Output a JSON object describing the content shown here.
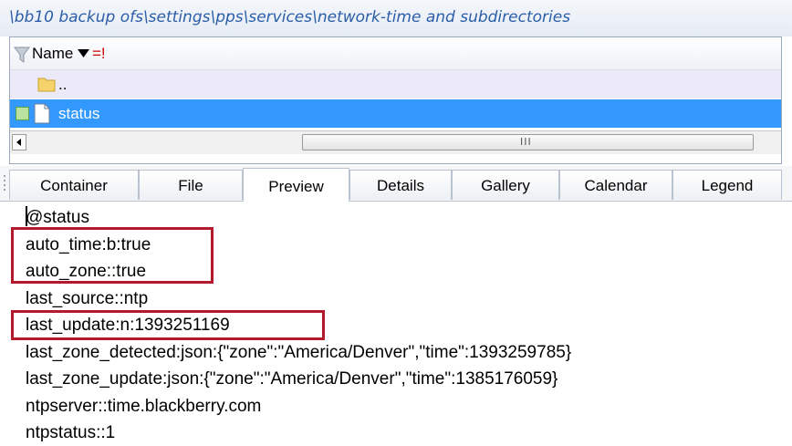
{
  "path": "\\bb10 backup ofs\\settings\\pps\\services\\network-time and subdirectories",
  "list": {
    "header_name": "Name",
    "header_filter": "=!",
    "parent_label": "..",
    "selected_label": "status",
    "scroll_grip": "III"
  },
  "tabs": [
    "Container",
    "File",
    "Preview",
    "Details",
    "Gallery",
    "Calendar",
    "Legend"
  ],
  "active_tab": "Preview",
  "preview_lines": [
    "@status",
    "auto_time:b:true",
    "auto_zone::true",
    "last_source::ntp",
    "last_update:n:1393251169",
    "last_zone_detected:json:{\"zone\":\"America/Denver\",\"time\":1393259785}",
    "last_zone_update:json:{\"zone\":\"America/Denver\",\"time\":1385176059}",
    "ntpserver::time.blackberry.com",
    "ntpstatus::1"
  ],
  "colors": {
    "path_text": "#2b5da8",
    "selection": "#3399ff",
    "highlight_box": "#b4192c",
    "filter_text": "#d00000"
  },
  "icons": [
    "filter-funnel-icon",
    "sort-down-icon",
    "folder-icon",
    "file-icon",
    "scroll-left-arrow-icon"
  ]
}
